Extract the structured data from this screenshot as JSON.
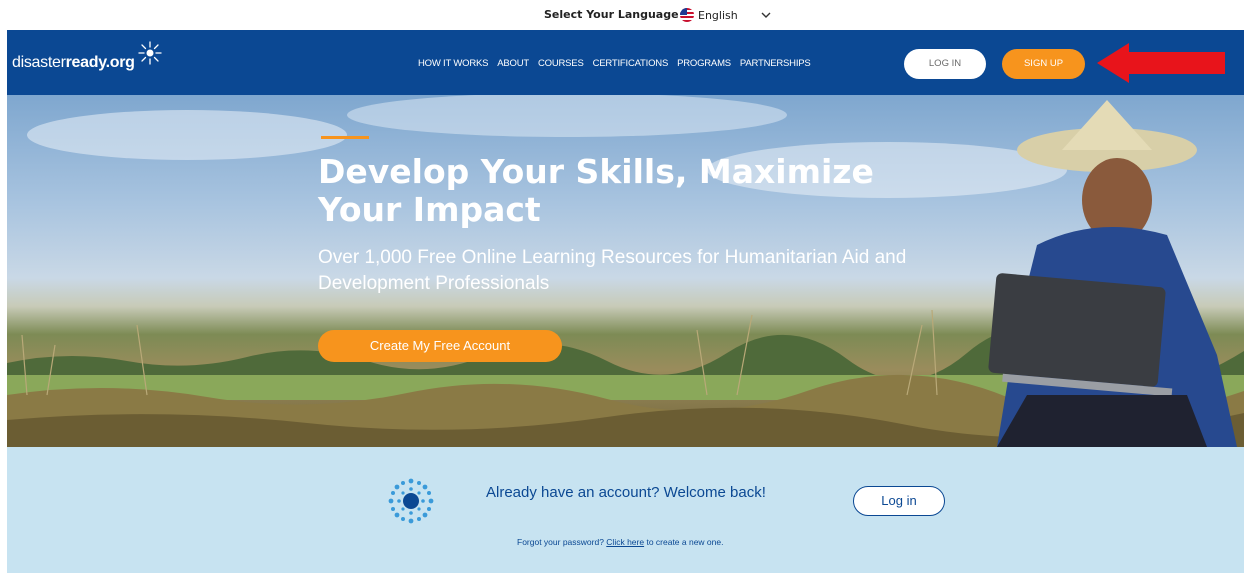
{
  "language_bar": {
    "label": "Select Your Language",
    "selected": "English",
    "flag_icon": "us-flag-icon",
    "chevron_icon": "chevron-down-icon"
  },
  "nav": {
    "logo_prefix": "disaster",
    "logo_bold": "ready.org",
    "menu": [
      "HOW IT WORKS",
      "ABOUT",
      "COURSES",
      "CERTIFICATIONS",
      "PROGRAMS",
      "PARTNERSHIPS"
    ],
    "login_label": "LOG IN",
    "signup_label": "SIGN UP",
    "arrow_icon": "red-arrow-left-icon"
  },
  "hero": {
    "headline": "Develop Your Skills, Maximize Your Impact",
    "subheadline": "Over 1,000 Free Online Learning Resources for Humanitarian Aid and Development Professionals",
    "cta_label": "Create My Free Account"
  },
  "welcome": {
    "title": "Already have an account? Welcome back!",
    "login_label": "Log in",
    "forgot_prefix": "Forgot your password? ",
    "forgot_link": "Click here",
    "forgot_suffix": " to create a new one."
  },
  "colors": {
    "brand_blue": "#0b4893",
    "accent_orange": "#f7941d",
    "band_blue": "#c7e3f1",
    "arrow_red": "#e8141b"
  }
}
